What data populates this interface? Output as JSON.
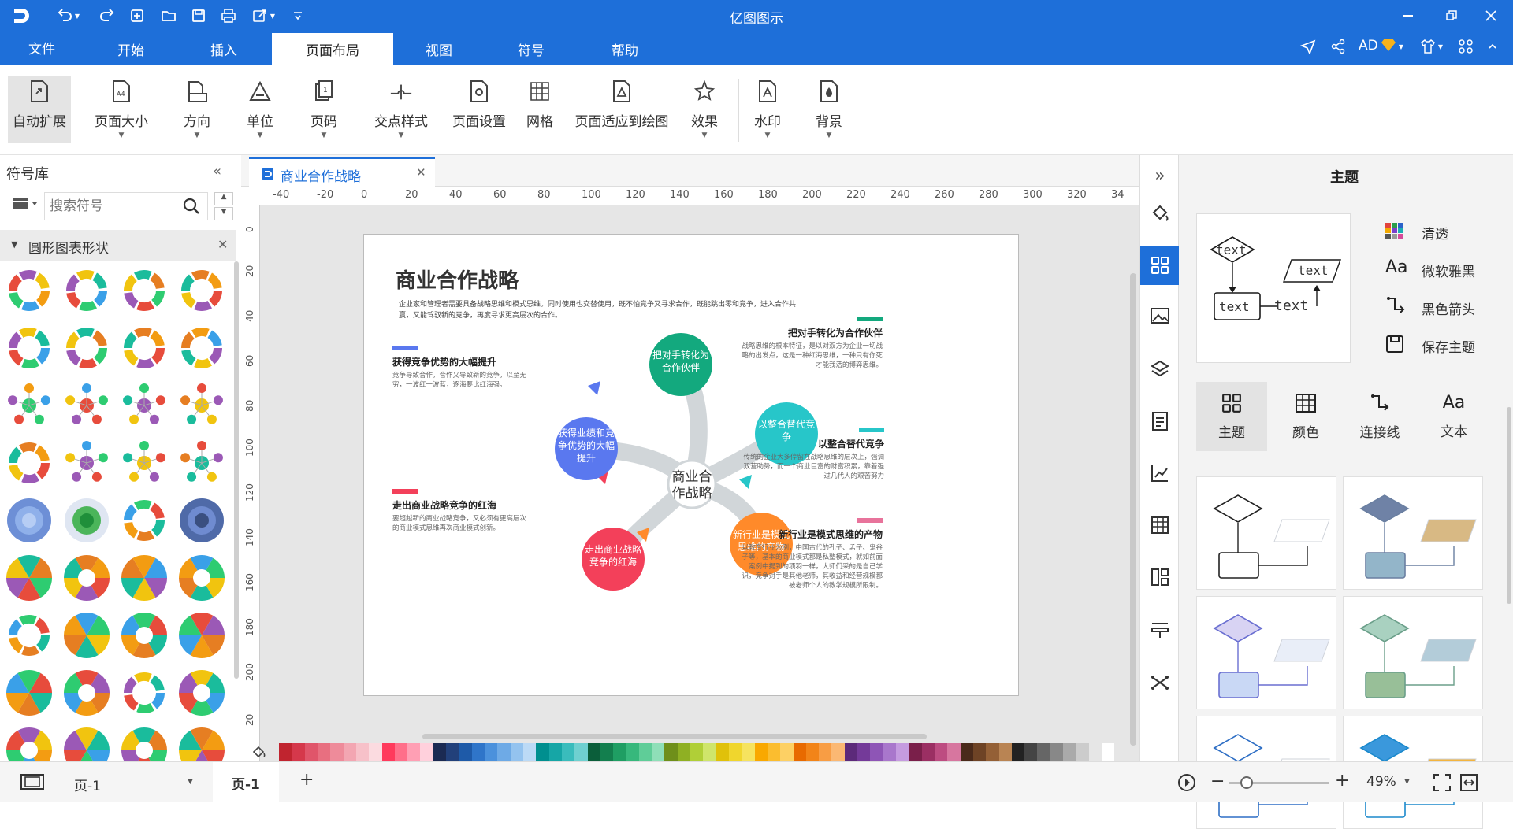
{
  "app": {
    "title": "亿图图示",
    "user": "AD"
  },
  "menu": {
    "file": "文件",
    "items": [
      "开始",
      "插入",
      "页面布局",
      "视图",
      "符号",
      "帮助"
    ],
    "active": "页面布局"
  },
  "ribbon": [
    {
      "label": "自动扩展",
      "icon": "auto-expand-icon",
      "dropdown": false
    },
    {
      "label": "页面大小",
      "icon": "page-size-icon",
      "dropdown": true
    },
    {
      "label": "方向",
      "icon": "orientation-icon",
      "dropdown": true
    },
    {
      "label": "单位",
      "icon": "unit-icon",
      "dropdown": true
    },
    {
      "label": "页码",
      "icon": "page-number-icon",
      "dropdown": true
    },
    {
      "label": "交点样式",
      "icon": "jump-style-icon",
      "dropdown": true
    },
    {
      "label": "页面设置",
      "icon": "page-setup-icon",
      "dropdown": false
    },
    {
      "label": "网格",
      "icon": "grid-icon",
      "dropdown": false
    },
    {
      "label": "页面适应到绘图",
      "icon": "fit-page-icon",
      "dropdown": false
    },
    {
      "label": "效果",
      "icon": "effect-icon",
      "dropdown": true
    },
    {
      "label": "水印",
      "icon": "watermark-icon",
      "dropdown": true
    },
    {
      "label": "背景",
      "icon": "background-icon",
      "dropdown": true
    }
  ],
  "library": {
    "title": "符号库",
    "search_placeholder": "搜索符号",
    "category": "圆形图表形状"
  },
  "doc_tab": {
    "name": "商业合作战略"
  },
  "ruler": {
    "h": [
      "-40",
      "-20",
      "0",
      "20",
      "40",
      "60",
      "80",
      "100",
      "120",
      "140",
      "160",
      "180",
      "200",
      "220",
      "240",
      "260",
      "280",
      "300",
      "320",
      "34"
    ],
    "v": [
      "0",
      "20",
      "40",
      "60",
      "80",
      "100",
      "120",
      "140",
      "160",
      "180",
      "200",
      "20"
    ]
  },
  "canvas": {
    "title": "商业合作战略",
    "intro": "企业家和管理者需要具备战略思维和模式思维。同时使用也交替使用，既不怕竞争又寻求合作，既能跳出零和竞争，进入合作共赢，又能驾驭新的竞争，再度寻求更高层次的合作。",
    "center": "商业合\n作战略",
    "nodes": [
      {
        "text": "把对手转化为合作伙伴",
        "color": "#13a97e"
      },
      {
        "text": "以整合替代竞争",
        "color": "#27c6c9"
      },
      {
        "text": "新行业是模式思维的产物",
        "color": "#ff8a2a"
      },
      {
        "text": "走出商业战略竞争的红海",
        "color": "#f3405a"
      },
      {
        "text": "获得业绩和竞争优势的大幅提升",
        "color": "#5a78ef"
      }
    ],
    "blocks": [
      {
        "title": "获得竞争优势的大幅提升",
        "body": "竞争导致合作，合作又导致新的竞争，以至无穷，一波红一波蓝，逐海要比红海强。",
        "bar": "#5a78ef"
      },
      {
        "title": "把对手转化为合作伙伴",
        "body": "战略思维的根本特征，是以对双方为企业一切战略的出发点，这是一种红海思维，一种只有你死才能我活的博弈思维。",
        "bar": "#13a97e"
      },
      {
        "title": "以整合替代竞争",
        "body": "传统的企业大多停留在战略思维的层次上，强调双营助势，而一个商业巨富的财富积累，靠着强过几代人的艰苦努力",
        "bar": "#27c6c9"
      },
      {
        "title": "走出商业战略竞争的红海",
        "body": "要超越新的商业战略竞争，又必须有更高层次的商业模式思维再次商业模式创新。",
        "bar": "#f3405a"
      },
      {
        "title": "新行业是模式思维的产物",
        "body": "以教育行业为例，中国古代的孔子、孟子、鬼谷子等，基本的商业模式都是私塾模式，就如前面案例中提到的项羽一样，大师们采的是自己学识，竞争对手是其他老师，其收益和经营规模都被老师个人的教学规模所限制。",
        "bar": "#e8739b"
      }
    ]
  },
  "rpanel": {
    "header": "主题",
    "preview_texts": [
      "text",
      "text",
      "text",
      "text"
    ],
    "options": [
      {
        "label": "清透",
        "icon": "palette-icon"
      },
      {
        "label": "微软雅黑",
        "icon": "font-icon"
      },
      {
        "label": "黑色箭头",
        "icon": "connector-icon"
      },
      {
        "label": "保存主题",
        "icon": "save-icon"
      }
    ],
    "tabs": [
      {
        "label": "主题",
        "icon": "theme-icon"
      },
      {
        "label": "颜色",
        "icon": "color-grid-icon"
      },
      {
        "label": "连接线",
        "icon": "connector-icon"
      },
      {
        "label": "文本",
        "icon": "text-icon"
      }
    ],
    "colors": {
      "accent": "#1e6fd9"
    }
  },
  "status": {
    "page_selector": "页-1",
    "page_tab": "页-1",
    "add": "+",
    "zoom": "49%"
  },
  "palette": [
    "#c0242f",
    "#d5384b",
    "#e0556a",
    "#e86f80",
    "#ee8b9a",
    "#f3a6b2",
    "#f7c1c9",
    "#fbdbe0",
    "#ff3a5c",
    "#ff6f8a",
    "#ff9fb4",
    "#ffd0dc",
    "#1b2a52",
    "#22407a",
    "#1e5aa8",
    "#2f75c9",
    "#4b91dc",
    "#6eaae6",
    "#94c3ef",
    "#bcdaf6",
    "#008f8f",
    "#16a6a6",
    "#3abcbc",
    "#6fd0d0",
    "#0b5e3a",
    "#137f4e",
    "#1f9e63",
    "#37b87c",
    "#5fcd98",
    "#8fdfb8",
    "#6f8f1a",
    "#8fb023",
    "#b0cf37",
    "#cfe56b",
    "#e0c10a",
    "#f0d62d",
    "#f6e35f",
    "#f9a800",
    "#fbbd2f",
    "#fdd064",
    "#e86a00",
    "#f28418",
    "#f89d44",
    "#fbb873",
    "#5c2a7a",
    "#743a99",
    "#8e55b6",
    "#a977cc",
    "#c59be0",
    "#7a1f4a",
    "#9b2f63",
    "#bd4c81",
    "#d7769f",
    "#4a2a1a",
    "#6e4325",
    "#946036",
    "#b98453",
    "#222222",
    "#444444",
    "#666666",
    "#888888",
    "#aaaaaa",
    "#cccccc",
    "#e6e6e6",
    "#ffffff"
  ]
}
